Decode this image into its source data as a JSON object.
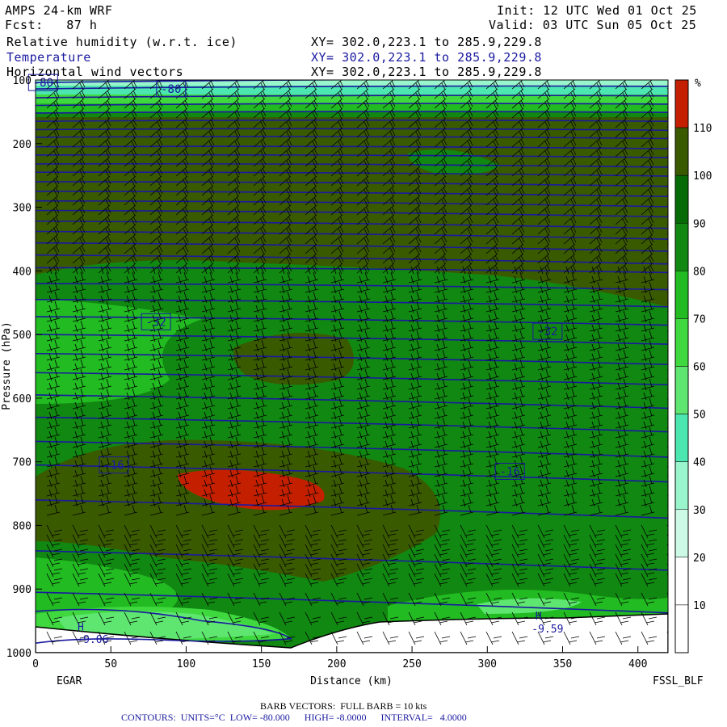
{
  "header": {
    "model": "AMPS 24-km WRF",
    "forecast": "Fcst:   87 h",
    "init": "Init: 12 UTC Wed 01 Oct 25",
    "valid": "Valid: 03 UTC Sun 05 Oct 25",
    "field1": "Relative humidity (w.r.t. ice)",
    "field2": "Temperature",
    "field3": "Horizontal wind vectors",
    "xy1": "XY= 302.0,223.1 to 285.9,229.8",
    "xy2": "XY= 302.0,223.1 to 285.9,229.8",
    "xy3": "XY= 302.0,223.1 to 285.9,229.8"
  },
  "footer": {
    "barb": "BARB VECTORS:  FULL BARB = 10 kts",
    "contours": "CONTOURS:  UNITS=°C  LOW= -80.000      HIGH= -8.0000      INTERVAL=   4.0000"
  },
  "endpoints": {
    "left": "EGAR",
    "right": "FSSL_BLF"
  },
  "chart_data": {
    "type": "heatmap",
    "xlabel": "Distance (km)",
    "ylabel": "Pressure (hPa)",
    "xlim": [
      0,
      420
    ],
    "ylim": [
      1000,
      100
    ],
    "x_ticks": [
      0,
      50,
      100,
      150,
      200,
      250,
      300,
      350,
      400
    ],
    "y_ticks": [
      100,
      200,
      300,
      400,
      500,
      600,
      700,
      800,
      900,
      1000
    ],
    "colorbar": {
      "unit": "%",
      "levels": [
        10,
        20,
        30,
        40,
        50,
        60,
        70,
        80,
        90,
        100,
        110
      ],
      "colors": [
        "#ffffff",
        "#ffffff",
        "#ccfae6",
        "#99f5cc",
        "#4ce6b0",
        "#5ee670",
        "#3fd83f",
        "#22bb22",
        "#118811",
        "#066b06",
        "#3a5a00",
        "#c42000"
      ]
    },
    "rh_regions": [
      {
        "name": "upper-moist",
        "value": 105
      },
      {
        "name": "near-saturated-250hPa",
        "value": 95
      },
      {
        "name": "mid-level",
        "value": 95
      },
      {
        "name": "supersaturated-730hPa",
        "value": 115
      },
      {
        "name": "low-level",
        "value": 85
      }
    ],
    "isotherm_labels": [
      {
        "label": "-80",
        "x": 5,
        "p": 104
      },
      {
        "label": "-80",
        "x": 90,
        "p": 114
      },
      {
        "label": "-32",
        "x": 80,
        "p": 480
      },
      {
        "label": "-32",
        "x": 340,
        "p": 495
      },
      {
        "label": "-16",
        "x": 52,
        "p": 705
      },
      {
        "label": "-16",
        "x": 315,
        "p": 715
      }
    ],
    "extrema": [
      {
        "label": "H",
        "x": 30,
        "p": 965
      },
      {
        "label": "-9.06",
        "x": 38,
        "p": 985
      },
      {
        "label": "H",
        "x": 334,
        "p": 948
      },
      {
        "label": "-9.59",
        "x": 340,
        "p": 968
      }
    ]
  }
}
